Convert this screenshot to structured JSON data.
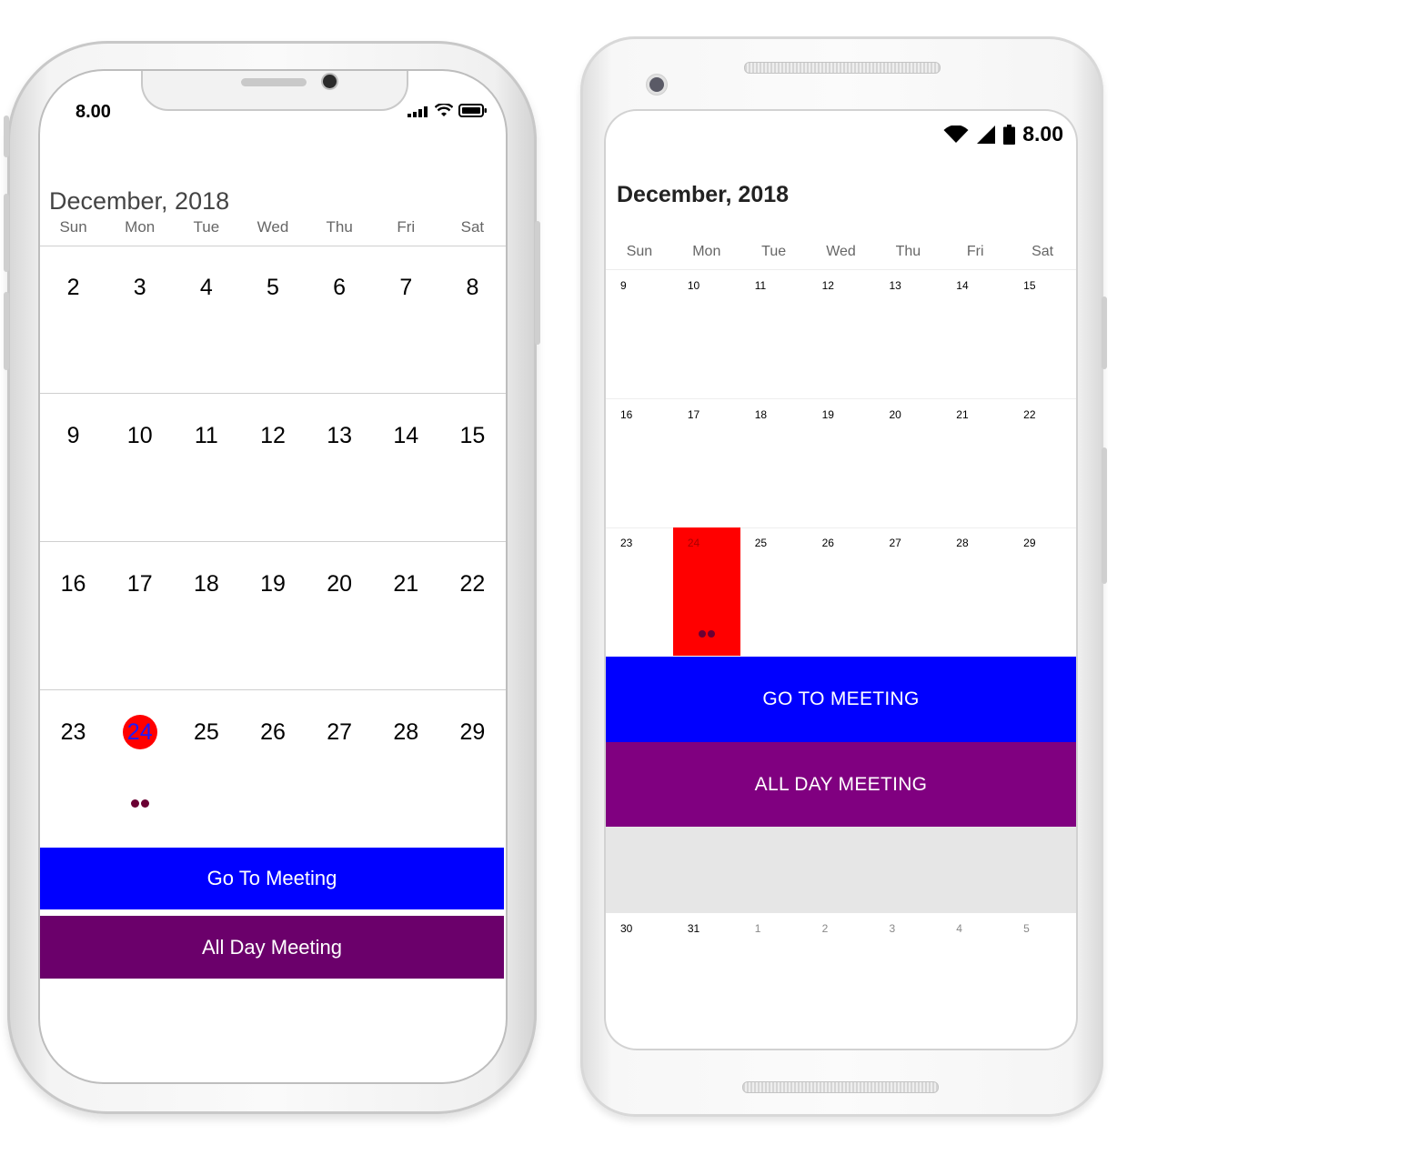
{
  "ios": {
    "time": "8.00",
    "month_title": "December, 2018",
    "day_headers": [
      "Sun",
      "Mon",
      "Tue",
      "Wed",
      "Thu",
      "Fri",
      "Sat"
    ],
    "weeks": [
      [
        "2",
        "3",
        "4",
        "5",
        "6",
        "7",
        "8"
      ],
      [
        "9",
        "10",
        "11",
        "12",
        "13",
        "14",
        "15"
      ],
      [
        "16",
        "17",
        "18",
        "19",
        "20",
        "21",
        "22"
      ],
      [
        "23",
        "24",
        "25",
        "26",
        "27",
        "28",
        "29"
      ]
    ],
    "selected_date": "24",
    "appointments": [
      {
        "label": "Go To Meeting",
        "color": "#0000ff"
      },
      {
        "label": "All Day Meeting",
        "color": "#6b006b"
      }
    ],
    "icons": [
      "signal-bars-icon",
      "wifi-icon",
      "battery-icon"
    ]
  },
  "android": {
    "time": "8.00",
    "month_title": "December, 2018",
    "day_headers": [
      "Sun",
      "Mon",
      "Tue",
      "Wed",
      "Thu",
      "Fri",
      "Sat"
    ],
    "weeks": [
      [
        "9",
        "10",
        "11",
        "12",
        "13",
        "14",
        "15"
      ],
      [
        "16",
        "17",
        "18",
        "19",
        "20",
        "21",
        "22"
      ],
      [
        "23",
        "24",
        "25",
        "26",
        "27",
        "28",
        "29"
      ]
    ],
    "last_week": [
      "30",
      "31",
      "1",
      "2",
      "3",
      "4",
      "5"
    ],
    "selected_date": "24",
    "appointments": [
      {
        "label": "GO TO MEETING",
        "color": "#0000ff"
      },
      {
        "label": "ALL DAY MEETING",
        "color": "#800080"
      }
    ],
    "icons": [
      "wifi-icon",
      "cellular-icon",
      "battery-icon"
    ]
  }
}
